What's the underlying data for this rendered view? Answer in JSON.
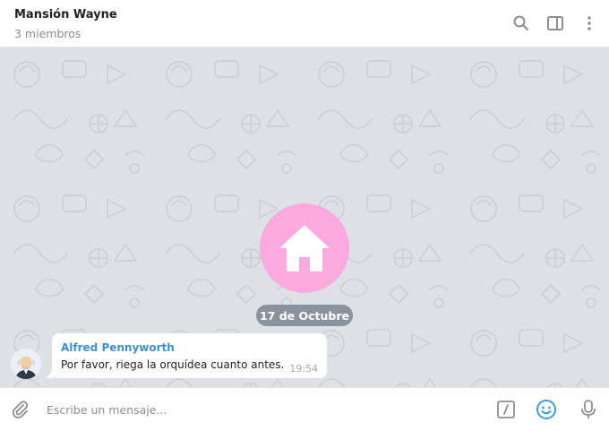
{
  "header": {
    "title": "Mansión Wayne",
    "subtitle": "3 miembros",
    "icons": [
      "search-icon",
      "sidebar-toggle-icon",
      "more-vertical-icon"
    ]
  },
  "chat": {
    "group_photo_icon": "home-icon",
    "group_photo_color": "#fba9de",
    "date_separator": "17 de Octubre",
    "messages": [
      {
        "author": "Alfred Pennyworth",
        "author_color": "#3f8fc9",
        "text": "Por favor, riega la orquídea cuanto antes.",
        "time": "19:54"
      }
    ]
  },
  "composer": {
    "placeholder": "Escribe un mensaje...",
    "icons": [
      "attach-icon",
      "bot-command-icon",
      "emoji-icon",
      "microphone-icon"
    ],
    "accent": "#3f9ade"
  }
}
